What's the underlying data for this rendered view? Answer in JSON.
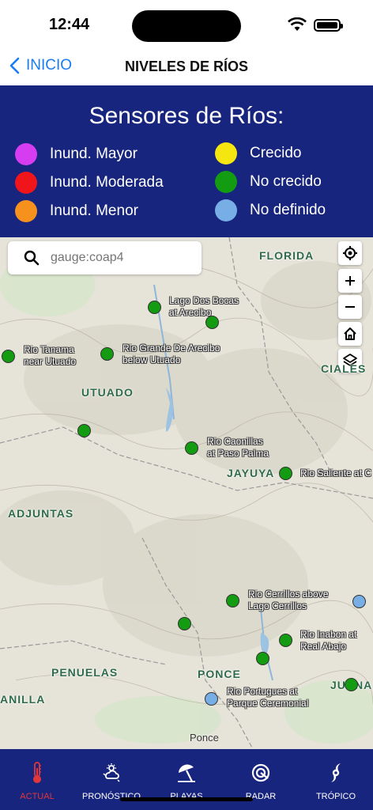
{
  "status": {
    "time": "12:44"
  },
  "nav": {
    "back_label": "INICIO",
    "title": "NIVELES DE RÍOS"
  },
  "legend": {
    "title": "Sensores de Ríos:",
    "items": [
      {
        "label": "Inund. Mayor",
        "color": "#d63cf0"
      },
      {
        "label": "Inund. Moderada",
        "color": "#f0141b"
      },
      {
        "label": "Inund. Menor",
        "color": "#f7911e"
      },
      {
        "label": "Crecido",
        "color": "#f5e60f"
      },
      {
        "label": "No crecido",
        "color": "#139b12"
      },
      {
        "label": "No definido",
        "color": "#78aee6"
      }
    ]
  },
  "search": {
    "placeholder": "gauge:coap4"
  },
  "map": {
    "places": [
      "FLORIDA",
      "CIALES",
      "UTUADO",
      "JAYUYA",
      "ADJUNTAS",
      "PENUELAS",
      "PONCE",
      "ANILLA",
      "JUANA"
    ],
    "city": "Ponce",
    "gauges": [
      {
        "label": "Lago Dos Bocas\nat Arecibo",
        "status": "No crecido"
      },
      {
        "label": "Rio Tanama\nnear Utuado",
        "status": "No crecido"
      },
      {
        "label": "Rio Grande De Arecibo\nbelow Utuado",
        "status": "No crecido"
      },
      {
        "label": "Rio Caonillas\nat Paso Palma",
        "status": "No crecido"
      },
      {
        "label": "Rio Saliente at C",
        "status": "No crecido"
      },
      {
        "label": "Rio Cerrillos above\nLago Cerrillos",
        "status": "No crecido"
      },
      {
        "label": "Rio Inabon at\nReal Abajo",
        "status": "No crecido"
      },
      {
        "label": "Rio Portugues at\nParque Ceremonial",
        "status": "No definido"
      }
    ]
  },
  "tabs": [
    {
      "label": "ACTUAL",
      "icon": "thermometer-icon",
      "active": true
    },
    {
      "label": "PRONÓSTICO",
      "icon": "forecast-icon",
      "active": false
    },
    {
      "label": "PLAYAS",
      "icon": "beach-umbrella-icon",
      "active": false
    },
    {
      "label": "RADAR",
      "icon": "radar-icon",
      "active": false
    },
    {
      "label": "TRÓPICO",
      "icon": "hurricane-icon",
      "active": false
    }
  ]
}
